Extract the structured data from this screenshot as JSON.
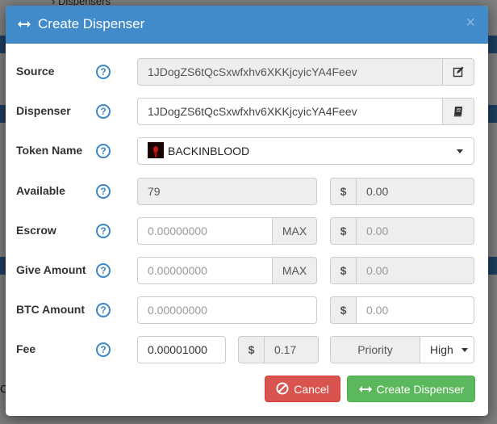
{
  "background": {
    "breadcrumb": "Dispensers",
    "letter_left": "C"
  },
  "modal": {
    "title": "Create Dispenser",
    "close": "×"
  },
  "form": {
    "source": {
      "label": "Source",
      "value": "1JDogZS6tQcSxwfxhv6XKKjcyicYA4Feev"
    },
    "dispenser": {
      "label": "Dispenser",
      "value": "1JDogZS6tQcSxwfxhv6XKKjcyicYA4Feev"
    },
    "token_name": {
      "label": "Token Name",
      "value": "BACKINBLOOD"
    },
    "available": {
      "label": "Available",
      "value": "79",
      "usd_symbol": "$",
      "usd_value": "0.00"
    },
    "escrow": {
      "label": "Escrow",
      "placeholder": "0.00000000",
      "max": "MAX",
      "usd_symbol": "$",
      "usd_placeholder": "0.00"
    },
    "give_amount": {
      "label": "Give Amount",
      "placeholder": "0.00000000",
      "max": "MAX",
      "usd_symbol": "$",
      "usd_placeholder": "0.00"
    },
    "btc_amount": {
      "label": "BTC Amount",
      "placeholder": "0.00000000",
      "usd_symbol": "$",
      "usd_placeholder": "0.00"
    },
    "fee": {
      "label": "Fee",
      "value": "0.00001000",
      "usd_symbol": "$",
      "usd_value": "0.17",
      "priority_label": "Priority",
      "priority_value": "High"
    },
    "help": "?"
  },
  "buttons": {
    "cancel": "Cancel",
    "create": "Create Dispenser"
  },
  "colors": {
    "header": "#428bca",
    "cancel": "#d9534f",
    "create": "#5cb85c",
    "help": "#3b86cb"
  },
  "icons": [
    "arrows-h-icon",
    "close-icon",
    "help-icon",
    "edit-icon",
    "book-icon",
    "token-icon",
    "caret-down-icon",
    "ban-icon"
  ]
}
